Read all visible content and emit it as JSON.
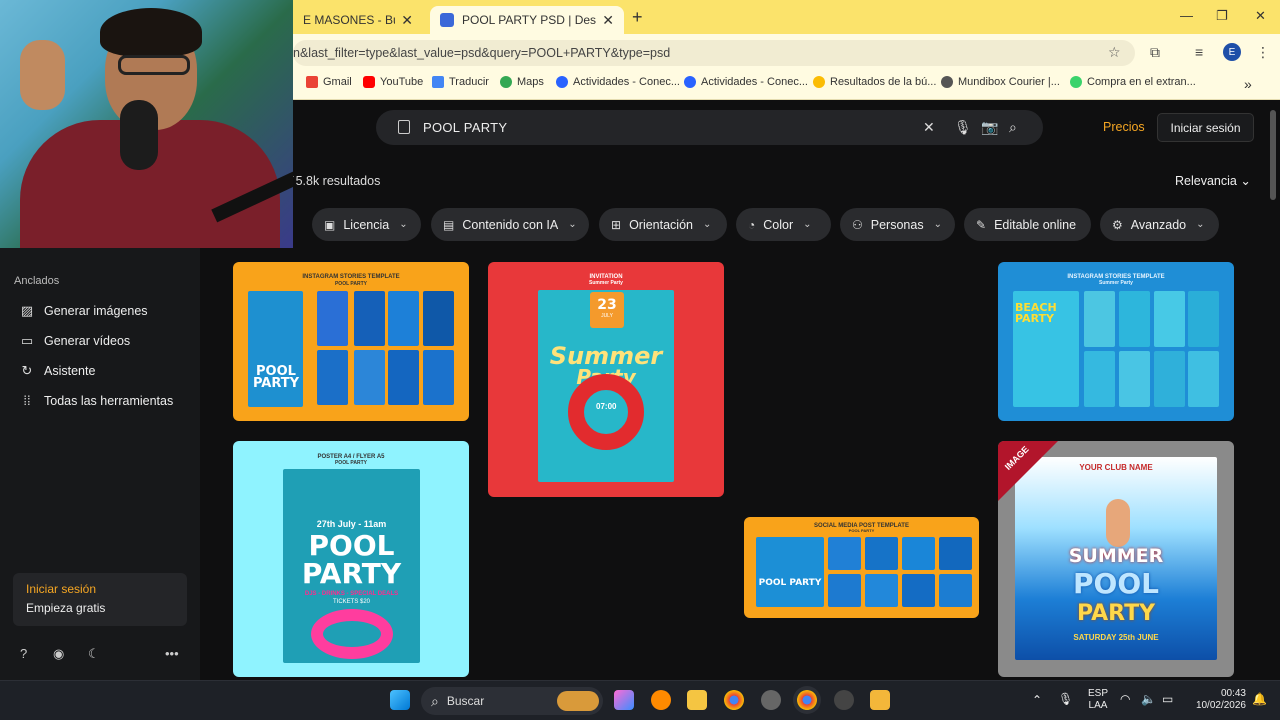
{
  "browser": {
    "tabs": [
      {
        "title": "E MASONES - Buscar c",
        "active": false
      },
      {
        "title": "POOL PARTY PSD | Descarga gr",
        "active": true
      }
    ],
    "url": "n&last_filter=type&last_value=psd&query=POOL+PARTY&type=psd",
    "bookmarks": [
      "Gmail",
      "YouTube",
      "Traducir",
      "Maps",
      "Actividades - Conec...",
      "Actividades - Conec...",
      "Resultados de la bú...",
      "Mundibox Courier |...",
      "Compra en el extran..."
    ],
    "profile_initial": "E"
  },
  "search": {
    "query": "POOL PARTY"
  },
  "header": {
    "pricing": "Precios",
    "login": "Iniciar sesión"
  },
  "results": {
    "count": "5.8k resultados",
    "sort": "Relevancia"
  },
  "filters": [
    "Licencia",
    "Contenido con IA",
    "Orientación",
    "Color",
    "Personas",
    "Editable online",
    "Avanzado"
  ],
  "sidebar": {
    "pinned_title": "Anclados",
    "items": [
      "Generar imágenes",
      "Generar vídeos",
      "Asistente",
      "Todas las herramientas"
    ],
    "card_login": "Iniciar sesión",
    "card_free": "Empieza gratis"
  },
  "cards": {
    "c1": {
      "label": "INSTAGRAM STORIES TEMPLATE",
      "sub": "POOL PARTY",
      "big": "POOL PARTY"
    },
    "c2": {
      "label": "INVITATION",
      "sub": "Summer Party",
      "date": "23",
      "month": "JULY",
      "big1": "Summer",
      "big2": "Party",
      "time": "07:00"
    },
    "c3": {
      "label": "INSTAGRAM STORIES TEMPLATE",
      "sub": "Summer Party",
      "big": "BEACH PARTY"
    },
    "c4": {
      "label": "POSTER A4 / FLYER A5",
      "sub": "POOL PARTY",
      "date": "27th July - 11am",
      "big1": "POOL",
      "big2": "PARTY",
      "line": "DJS - DRINKS - SPECIAL DEALS",
      "tickets": "TICKETS $20"
    },
    "c5": {
      "label": "SOCIAL MEDIA POST TEMPLATE",
      "sub": "POOL PARTY",
      "big": "POOL PARTY"
    },
    "c6": {
      "club": "YOUR CLUB NAME",
      "big1": "SUMMER",
      "big2": "POOL",
      "big3": "PARTY",
      "date": "SATURDAY 25th JUNE",
      "badge": "IMAGE"
    }
  },
  "taskbar": {
    "search": "Buscar",
    "lang1": "ESP",
    "lang2": "LAA",
    "time": "00:43",
    "date": "10/02/2026"
  },
  "colors": {
    "accent": "#f5a623",
    "tabbar": "#fbe36b",
    "page_bg": "#0f0f10"
  }
}
